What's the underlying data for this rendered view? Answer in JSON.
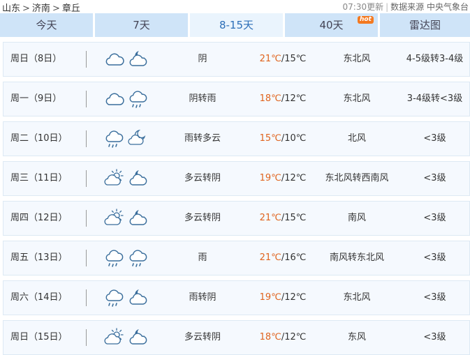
{
  "breadcrumb": {
    "province": "山东",
    "city": "济南",
    "district": "章丘",
    "sep": ">"
  },
  "meta": {
    "update": "07:30更新",
    "divider": "|",
    "source": "数据来源 中央气象台"
  },
  "tabs": [
    {
      "label": "今天"
    },
    {
      "label": "7天"
    },
    {
      "label": "8-15天"
    },
    {
      "label": "40天",
      "badge": "hot"
    },
    {
      "label": "雷达图"
    }
  ],
  "colors": {
    "tab_bg": "#cfe4f8",
    "tab_active_bg": "#eaf4fd",
    "row_bg": "#f5f9fe",
    "high_temp": "#e0641e",
    "hot_badge": "#f47920",
    "icon_stroke": "#3a6e9c"
  },
  "days": [
    {
      "day": "周日（8日）",
      "icons": [
        "cloud-icon",
        "cloudy-night-icon"
      ],
      "weather": "阴",
      "high": "21℃",
      "low": "/15℃",
      "wind": "东北风",
      "level": "4-5级转3-4级"
    },
    {
      "day": "周一（9日）",
      "icons": [
        "cloud-icon",
        "rain-icon"
      ],
      "weather": "阴转雨",
      "high": "18℃",
      "low": "/12℃",
      "wind": "东北风",
      "level": "3-4级转<3级"
    },
    {
      "day": "周二（10日）",
      "icons": [
        "rain-icon",
        "partly-cloudy-night-icon"
      ],
      "weather": "雨转多云",
      "high": "15℃",
      "low": "/10℃",
      "wind": "北风",
      "level": "<3级"
    },
    {
      "day": "周三（11日）",
      "icons": [
        "partly-cloudy-day-icon",
        "cloudy-night-icon"
      ],
      "weather": "多云转阴",
      "high": "19℃",
      "low": "/12℃",
      "wind": "东北风转西南风",
      "level": "<3级"
    },
    {
      "day": "周四（12日）",
      "icons": [
        "partly-cloudy-day-icon",
        "cloudy-night-icon"
      ],
      "weather": "多云转阴",
      "high": "21℃",
      "low": "/15℃",
      "wind": "南风",
      "level": "<3级"
    },
    {
      "day": "周五（13日）",
      "icons": [
        "rain-icon",
        "rain-icon"
      ],
      "weather": "雨",
      "high": "21℃",
      "low": "/16℃",
      "wind": "南风转东北风",
      "level": "<3级"
    },
    {
      "day": "周六（14日）",
      "icons": [
        "rain-icon",
        "cloudy-night-icon"
      ],
      "weather": "雨转阴",
      "high": "19℃",
      "low": "/12℃",
      "wind": "东北风",
      "level": "<3级"
    },
    {
      "day": "周日（15日）",
      "icons": [
        "partly-cloudy-day-icon",
        "cloudy-night-icon"
      ],
      "weather": "多云转阴",
      "high": "18℃",
      "low": "/12℃",
      "wind": "东风",
      "level": "<3级"
    }
  ]
}
